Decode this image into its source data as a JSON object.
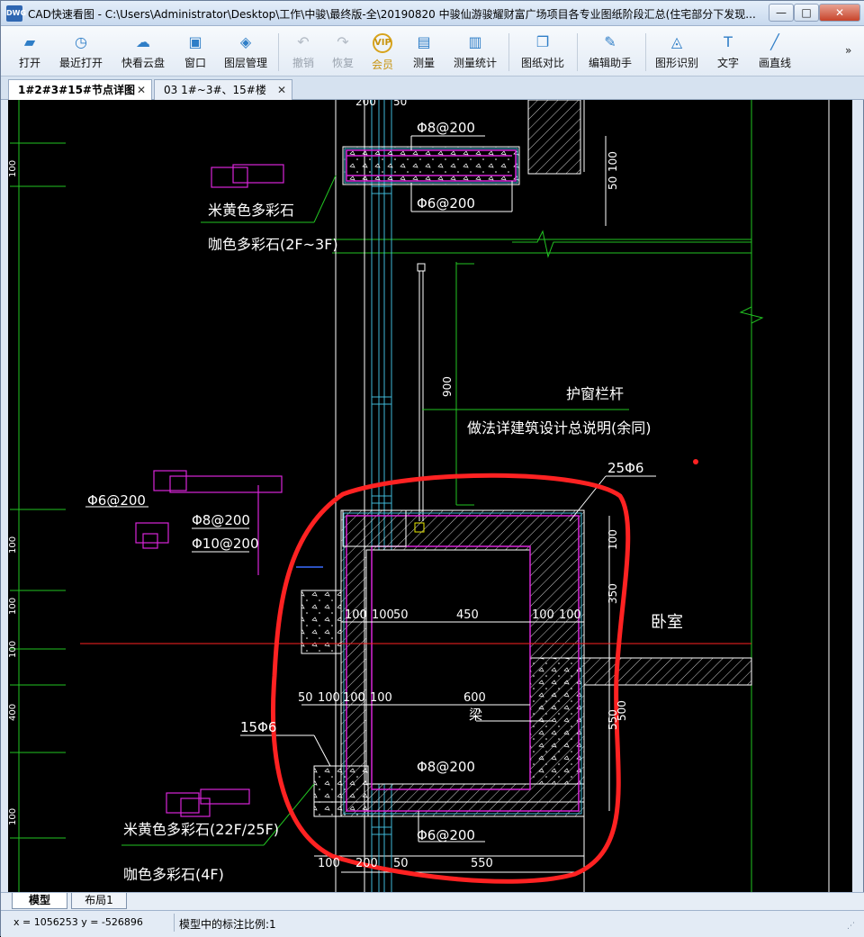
{
  "titlebar": {
    "app_icon": "DWG",
    "title": "CAD快速看图 - C:\\Users\\Administrator\\Desktop\\工作\\中骏\\最终版-全\\20190820 中骏仙游骏耀财富广场项目各专业图纸阶段汇总(住宅部分下发现...",
    "minimize": "—",
    "maximize": "□",
    "close": "✕"
  },
  "toolbar": {
    "items": [
      {
        "label": "打开",
        "icon": "folder-open-icon",
        "glyph": "▰"
      },
      {
        "label": "最近打开",
        "icon": "clock-icon",
        "glyph": "◷"
      },
      {
        "label": "快看云盘",
        "icon": "cloud-icon",
        "glyph": "☁"
      },
      {
        "label": "窗口",
        "icon": "window-select-icon",
        "glyph": "▣"
      },
      {
        "label": "图层管理",
        "icon": "layers-icon",
        "glyph": "◈"
      },
      {
        "label": "撤销",
        "icon": "undo-icon",
        "glyph": "↶"
      },
      {
        "label": "恢复",
        "icon": "redo-icon",
        "glyph": "↷"
      },
      {
        "label": "会员",
        "icon": "vip-icon",
        "glyph": "VIP"
      },
      {
        "label": "测量",
        "icon": "ruler-icon",
        "glyph": "▤"
      },
      {
        "label": "测量统计",
        "icon": "measure-stats-icon",
        "glyph": "▥"
      },
      {
        "label": "图纸对比",
        "icon": "compare-icon",
        "glyph": "❐"
      },
      {
        "label": "编辑助手",
        "icon": "edit-assistant-icon",
        "glyph": "✎"
      },
      {
        "label": "图形识别",
        "icon": "shape-recognition-icon",
        "glyph": "◬"
      },
      {
        "label": "文字",
        "icon": "text-icon",
        "glyph": "T"
      },
      {
        "label": "画直线",
        "icon": "line-icon",
        "glyph": "╱"
      }
    ],
    "more": "»"
  },
  "tabs": [
    {
      "label": "1#2#3#15#节点详图",
      "close": "✕"
    },
    {
      "label": "03 1#~3#、15#楼",
      "close": "✕"
    }
  ],
  "drawing": {
    "labels": {
      "t1": "Φ8@200",
      "t2": "Φ6@200",
      "t3": "米黄色多彩石",
      "t4": "咖色多彩石(2F~3F)",
      "t5": "900",
      "t6": "护窗栏杆",
      "t7": "做法详建筑设计总说明(余同)",
      "t8": "25Φ6",
      "t9": "Φ6@200",
      "t10": "Φ8@200",
      "t11": "Φ10@200",
      "t12": "100",
      "t13": "350",
      "t14": "卧室",
      "t15": "100",
      "t16": "100",
      "t17": "50",
      "t18": "450",
      "t19": "100",
      "t20": "100",
      "t21": "50",
      "t22": "100",
      "t23": "100",
      "t24": "100",
      "t25": "600",
      "t26": "梁",
      "t27": "550",
      "t28": "15Φ6",
      "t29": "Φ8@200",
      "t30": "米黄色多彩石(22F/25F)",
      "t31": "Φ6@200",
      "t32": "咖色多彩石(4F)",
      "t33": "100",
      "t34": "200",
      "t35": "50",
      "t36": "550",
      "t37": "100",
      "t38": "50",
      "t39": "100",
      "t40": "100",
      "t41": "500",
      "t42": "400",
      "t43": "100",
      "t44": "100",
      "t45": "100",
      "t46": "200",
      "t47": "50"
    }
  },
  "layout_tabs": [
    {
      "label": "模型"
    },
    {
      "label": "布局1"
    }
  ],
  "status": {
    "coords": "x = 1056253  y = -526896",
    "scale": "模型中的标注比例:1",
    "grip": "⋰"
  },
  "colors": {
    "green": "#22c422",
    "white": "#ffffff",
    "magenta": "#d826d8",
    "cyan": "#3fb9d8",
    "red": "#ff2222",
    "yellow": "#e8e800",
    "blue": "#3a6cff"
  }
}
